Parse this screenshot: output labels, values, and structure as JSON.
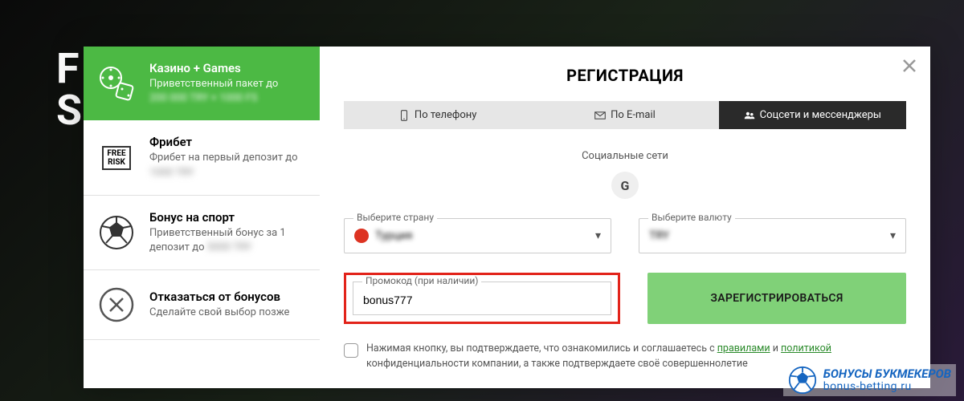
{
  "bg": {
    "line1": "F",
    "line2": "S"
  },
  "sidebar": {
    "items": [
      {
        "title": "Казино + Games",
        "sub": "Приветственный пакет до",
        "blurred": "200 000 TRY + 1000 FS"
      },
      {
        "title": "Фрибет",
        "sub": "Фрибет на первый депозит до",
        "blurred": "1000 TRY"
      },
      {
        "title": "Бонус на спорт",
        "sub": "Приветственный бонус за 1 депозит до",
        "blurred": "5000 TRY"
      },
      {
        "title": "Отказаться от бонусов",
        "sub": "Сделайте свой выбор позже"
      }
    ]
  },
  "main": {
    "heading": "РЕГИСТРАЦИЯ",
    "tabs": {
      "phone": "По телефону",
      "email": "По E-mail",
      "social": "Соцсети и мессенджеры"
    },
    "social_label": "Социальные сети",
    "google_letter": "G",
    "country": {
      "label": "Выберите страну",
      "value_blurred": "Турция"
    },
    "currency": {
      "label": "Выберите валюту",
      "value_blurred": "TRY"
    },
    "promo": {
      "label": "Промокод (при наличии)",
      "value": "bonus777"
    },
    "register_btn": "ЗАРЕГИСТРИРОВАТЬСЯ",
    "consent": {
      "pre": "Нажимая кнопку, вы подтверждаете, что ознакомились и соглашаетесь с ",
      "rules": "правилами",
      "and": " и ",
      "policy": "политикой",
      "post": " конфиденциальности компании, а также подтверждаете своё совершеннолетие"
    }
  },
  "brand": {
    "line1": "БОНУСЫ БУКМЕКЕРОВ",
    "line2": "bonus-betting.ru"
  }
}
